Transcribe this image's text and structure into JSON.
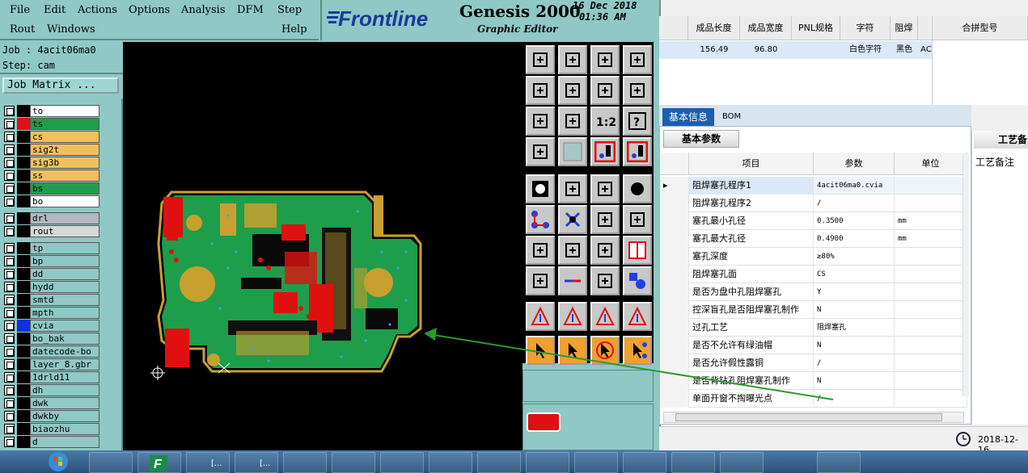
{
  "menubar": {
    "row1": [
      "File",
      "Edit",
      "Actions",
      "Options",
      "Analysis",
      "DFM",
      "Step"
    ],
    "row2": [
      "Rout",
      "Windows",
      "Help"
    ]
  },
  "brand": {
    "logo": "Frontline",
    "title": "Genesis 2000",
    "subtitle": "Graphic Editor",
    "date": "16 Dec 2018",
    "time": "01:36 AM"
  },
  "job": {
    "job_line": "Job : 4acit06ma0",
    "step_line": "Step: cam",
    "matrix_button": "Job Matrix ..."
  },
  "layers": [
    {
      "name": "to",
      "color": "#ffffff",
      "sw": "#000000"
    },
    {
      "name": "ts",
      "color": "#1e9e4a",
      "sw": "#e01010",
      "active": true
    },
    {
      "name": "cs",
      "color": "#f0c060",
      "sw": "#000000"
    },
    {
      "name": "sig2t",
      "color": "#f0c060",
      "sw": "#000000"
    },
    {
      "name": "sig3b",
      "color": "#f0c060",
      "sw": "#000000"
    },
    {
      "name": "ss",
      "color": "#f0c060",
      "sw": "#000000"
    },
    {
      "name": "bs",
      "color": "#1e9e4a",
      "sw": "#000000"
    },
    {
      "name": "bo",
      "color": "#ffffff",
      "sw": "#000000"
    },
    {
      "name": "drl",
      "color": "#b0b8c0",
      "sw": "#000000"
    },
    {
      "name": "rout",
      "color": "#d8d8d8",
      "sw": "#000000"
    },
    {
      "name": "tp",
      "color": "#8fc8c4",
      "sw": "#000000"
    },
    {
      "name": "bp",
      "color": "#8fc8c4",
      "sw": "#000000"
    },
    {
      "name": "dd",
      "color": "#8fc8c4",
      "sw": "#000000"
    },
    {
      "name": "hydd",
      "color": "#8fc8c4",
      "sw": "#000000"
    },
    {
      "name": "smtd",
      "color": "#8fc8c4",
      "sw": "#000000"
    },
    {
      "name": "mpth",
      "color": "#8fc8c4",
      "sw": "#000000"
    },
    {
      "name": "cvia",
      "color": "#8fc8c4",
      "sw": "#1030e0"
    },
    {
      "name": "bo_bak",
      "color": "#8fc8c4",
      "sw": "#000000"
    },
    {
      "name": "datecode-bo",
      "color": "#8fc8c4",
      "sw": "#000000"
    },
    {
      "name": "layer_8.gbr",
      "color": "#8fc8c4",
      "sw": "#000000"
    },
    {
      "name": "1drld11",
      "color": "#8fc8c4",
      "sw": "#000000"
    },
    {
      "name": "dh",
      "color": "#8fc8c4",
      "sw": "#000000"
    },
    {
      "name": "dwk",
      "color": "#8fc8c4",
      "sw": "#000000"
    },
    {
      "name": "dwkby",
      "color": "#8fc8c4",
      "sw": "#000000"
    },
    {
      "name": "biaozhu",
      "color": "#8fc8c4",
      "sw": "#000000"
    },
    {
      "name": "d",
      "color": "#8fc8c4",
      "sw": "#000000"
    }
  ],
  "tools": {
    "button_2": "1:2",
    "button_3": "?"
  },
  "right_app": {
    "top_headers": [
      "成品长度",
      "成品宽度",
      "PNL规格",
      "字符",
      "阻焊",
      "合拼型号"
    ],
    "top_values": [
      "156.49",
      "96.80",
      "",
      "白色字符",
      "黑色",
      "AC"
    ],
    "tabs": [
      "基本信息",
      "BOM"
    ],
    "subtab": "基本参数",
    "right_tab": "工艺备",
    "right_label": "工艺备注",
    "grid_headers": [
      "项目",
      "参数",
      "单位"
    ],
    "rows": [
      {
        "item": "阻焊塞孔程序1",
        "value": "4acit06ma0.cvia",
        "unit": ""
      },
      {
        "item": "阻焊塞孔程序2",
        "value": "/",
        "unit": ""
      },
      {
        "item": "塞孔最小孔径",
        "value": "0.3500",
        "unit": "mm"
      },
      {
        "item": "塞孔最大孔径",
        "value": "0.4900",
        "unit": "mm"
      },
      {
        "item": "塞孔深度",
        "value": "≥80%",
        "unit": ""
      },
      {
        "item": "阻焊塞孔面",
        "value": "CS",
        "unit": ""
      },
      {
        "item": "是否为盘中孔阻焊塞孔",
        "value": "Y",
        "unit": ""
      },
      {
        "item": "控深盲孔是否阻焊塞孔制作",
        "value": "N",
        "unit": ""
      },
      {
        "item": "过孔工艺",
        "value": "阻焊塞孔",
        "unit": ""
      },
      {
        "item": "是否不允许有绿油帽",
        "value": "N",
        "unit": ""
      },
      {
        "item": "是否允许假性露铜",
        "value": "/",
        "unit": ""
      },
      {
        "item": "是否背钻孔阻焊塞孔制作",
        "value": "N",
        "unit": ""
      },
      {
        "item": "单面开窗不掏曝光点",
        "value": "/",
        "unit": ""
      }
    ],
    "status_date": "2018-12-16"
  },
  "taskbar": {
    "labels": [
      "[...",
      "[..."
    ]
  },
  "colors": {
    "genesis_bg": "#8fc8c4",
    "pcb_green": "#1e9e4a",
    "pcb_gold": "#c8a030",
    "pcb_red": "#e01010",
    "arrow_green": "#2a9a2a",
    "selected_tab": "#1c5fb0"
  }
}
